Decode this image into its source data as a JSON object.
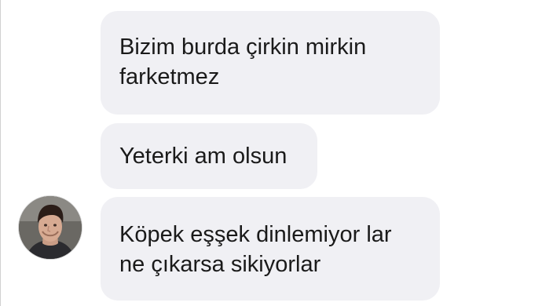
{
  "conversation": {
    "messages": [
      {
        "lines": [
          "Bizim burda çirkin mirkin",
          "farketmez"
        ]
      },
      {
        "lines": [
          "Yeterki am olsun"
        ]
      },
      {
        "lines": [
          "Köpek eşşek dinlemiyor lar",
          "ne çıkarsa sikiyorlar"
        ]
      }
    ]
  },
  "avatar": {
    "icon": "user-avatar-photo"
  },
  "colors": {
    "bubble_background": "#f0f0f4",
    "text": "#1a1a1a",
    "background": "#ffffff"
  }
}
